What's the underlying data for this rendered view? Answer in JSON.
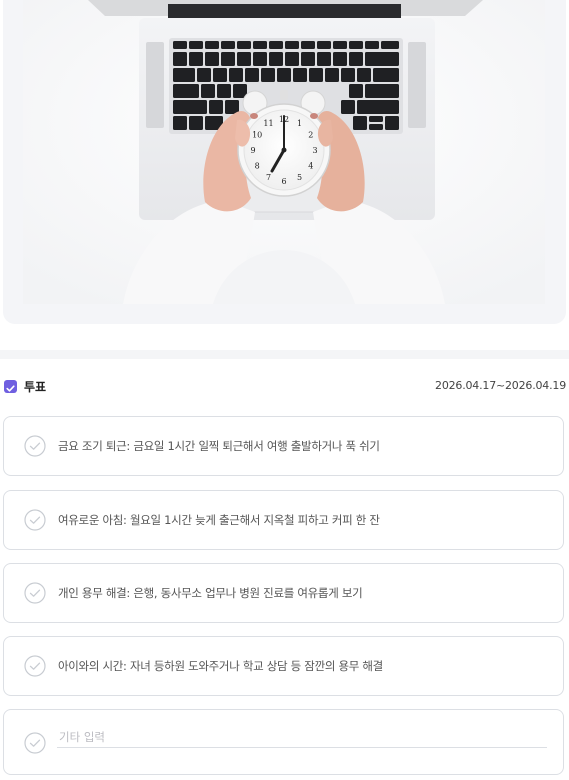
{
  "photo": {
    "alt": "alarm-clock-over-laptop-photo",
    "clock_numbers": [
      "12",
      "1",
      "2",
      "3",
      "4",
      "5",
      "6",
      "7",
      "8",
      "9",
      "10",
      "11"
    ]
  },
  "vote": {
    "title": "투표",
    "period": "2026.04.17~2026.04.19",
    "options": [
      {
        "label": "금요 조기 퇴근: 금요일 1시간 일찍 퇴근해서 여행 출발하거나 푹 쉬기"
      },
      {
        "label": "여유로운 아침: 월요일 1시간 늦게 출근해서 지옥철 피하고 커피 한 잔"
      },
      {
        "label": "개인 용무 해결: 은행, 동사무소 업무나 병원 진료를 여유롭게 보기"
      },
      {
        "label": "아이와의 시간: 자녀 등하원 도와주거나 학교 상담 등 잠깐의 용무 해결"
      }
    ],
    "other": {
      "placeholder": "기타 입력",
      "value": ""
    }
  },
  "colors": {
    "accent": "#6f5fe0",
    "border": "#dcdfe4",
    "circle": "#c8ccd2",
    "band": "#f4f5f7"
  }
}
